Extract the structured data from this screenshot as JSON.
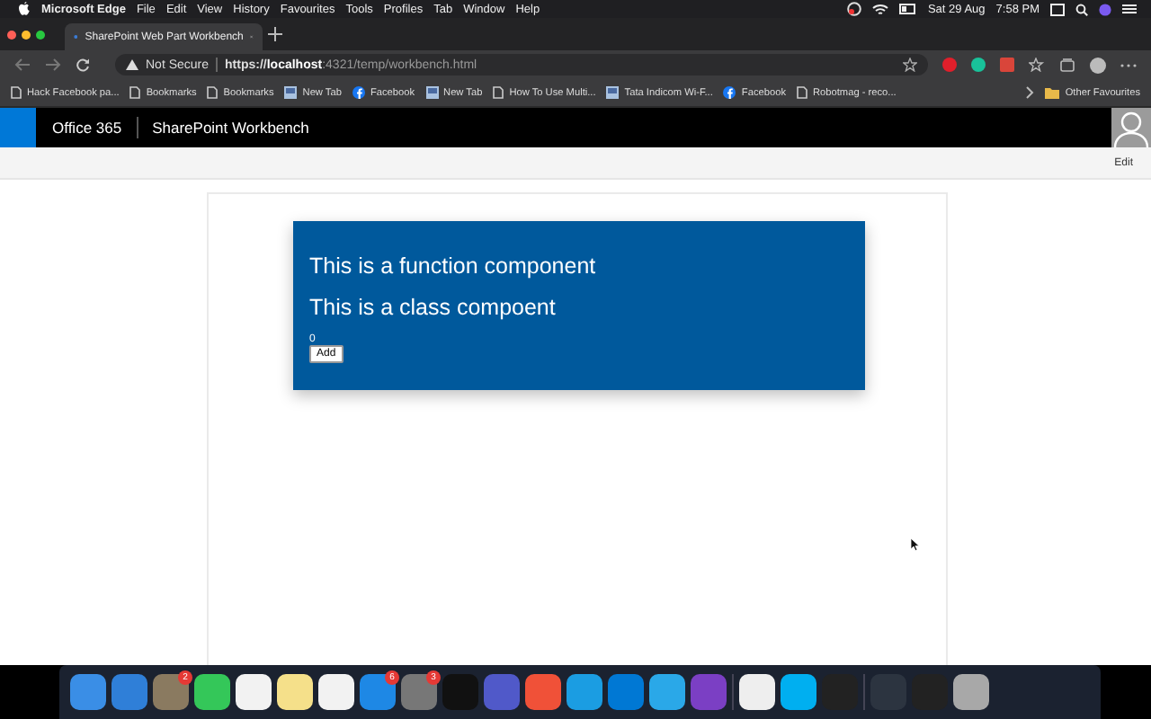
{
  "menu_bar": {
    "app": "Microsoft Edge",
    "items": [
      "File",
      "Edit",
      "View",
      "History",
      "Favourites",
      "Tools",
      "Profiles",
      "Tab",
      "Window",
      "Help"
    ],
    "date": "Sat 29 Aug",
    "time": "7:58 PM"
  },
  "tab": {
    "title": "SharePoint Web Part Workbench",
    "selected": true
  },
  "address_bar": {
    "security": "Not Secure",
    "scheme": "https://",
    "host": "localhost",
    "rest": ":4321/temp/workbench.html"
  },
  "bookmarks": [
    {
      "label": "Hack Facebook pa...",
      "kind": "page"
    },
    {
      "label": "Bookmarks",
      "kind": "page"
    },
    {
      "label": "Bookmarks",
      "kind": "page"
    },
    {
      "label": "New Tab",
      "kind": "tile"
    },
    {
      "label": "Facebook",
      "kind": "facebook"
    },
    {
      "label": "New Tab",
      "kind": "tile"
    },
    {
      "label": "How To Use Multi...",
      "kind": "page"
    },
    {
      "label": "Tata Indicom Wi-F...",
      "kind": "tile"
    },
    {
      "label": "Facebook",
      "kind": "facebook"
    },
    {
      "label": "Robotmag - reco...",
      "kind": "page"
    }
  ],
  "other_favourites": "Other Favourites",
  "suite_bar": {
    "brand": "Office 365",
    "title": "SharePoint Workbench"
  },
  "command_bar": {
    "edit": "Edit"
  },
  "web_part": {
    "headings": [
      "This is a function component",
      "This is a class compoent"
    ],
    "count": "0",
    "button": "Add"
  },
  "dock": {
    "mail_badge": "2",
    "app_store_badge": "6",
    "settings_badge": "3"
  }
}
